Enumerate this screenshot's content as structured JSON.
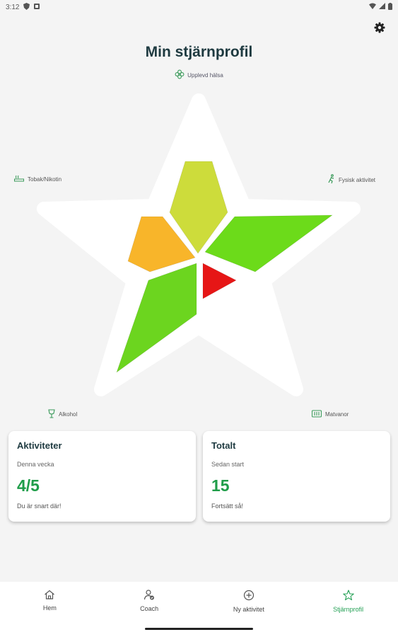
{
  "status": {
    "time": "3:12"
  },
  "header": {
    "title": "Min stjärnprofil",
    "subtitle": "Upplevd hälsa"
  },
  "categories": {
    "tobacco": "Tobak/Nikotin",
    "physical": "Fysisk aktivitet",
    "alcohol": "Alkohol",
    "food": "Matvanor"
  },
  "star_segments": [
    {
      "name": "upplevd-halsa",
      "color": "#cddc3b"
    },
    {
      "name": "fysisk-aktivitet",
      "color": "#6cdb1a"
    },
    {
      "name": "matvanor",
      "color": "#e61616"
    },
    {
      "name": "alkohol",
      "color": "#6cd51f"
    },
    {
      "name": "tobak-nikotin",
      "color": "#f8b52a"
    }
  ],
  "cards": {
    "activities": {
      "title": "Aktiviteter",
      "subtitle": "Denna vecka",
      "value": "4/5",
      "note": "Du är snart där!"
    },
    "total": {
      "title": "Totalt",
      "subtitle": "Sedan start",
      "value": "15",
      "note": "Fortsätt så!"
    }
  },
  "nav": [
    {
      "label": "Hem",
      "icon": "home-icon"
    },
    {
      "label": "Coach",
      "icon": "coach-icon"
    },
    {
      "label": "Ny aktivitet",
      "icon": "add-circle-icon"
    },
    {
      "label": "Stjärnprofil",
      "icon": "star-icon"
    }
  ],
  "colors": {
    "accent": "#24a055",
    "value_green": "#1f9d49",
    "title": "#1e3a40"
  }
}
